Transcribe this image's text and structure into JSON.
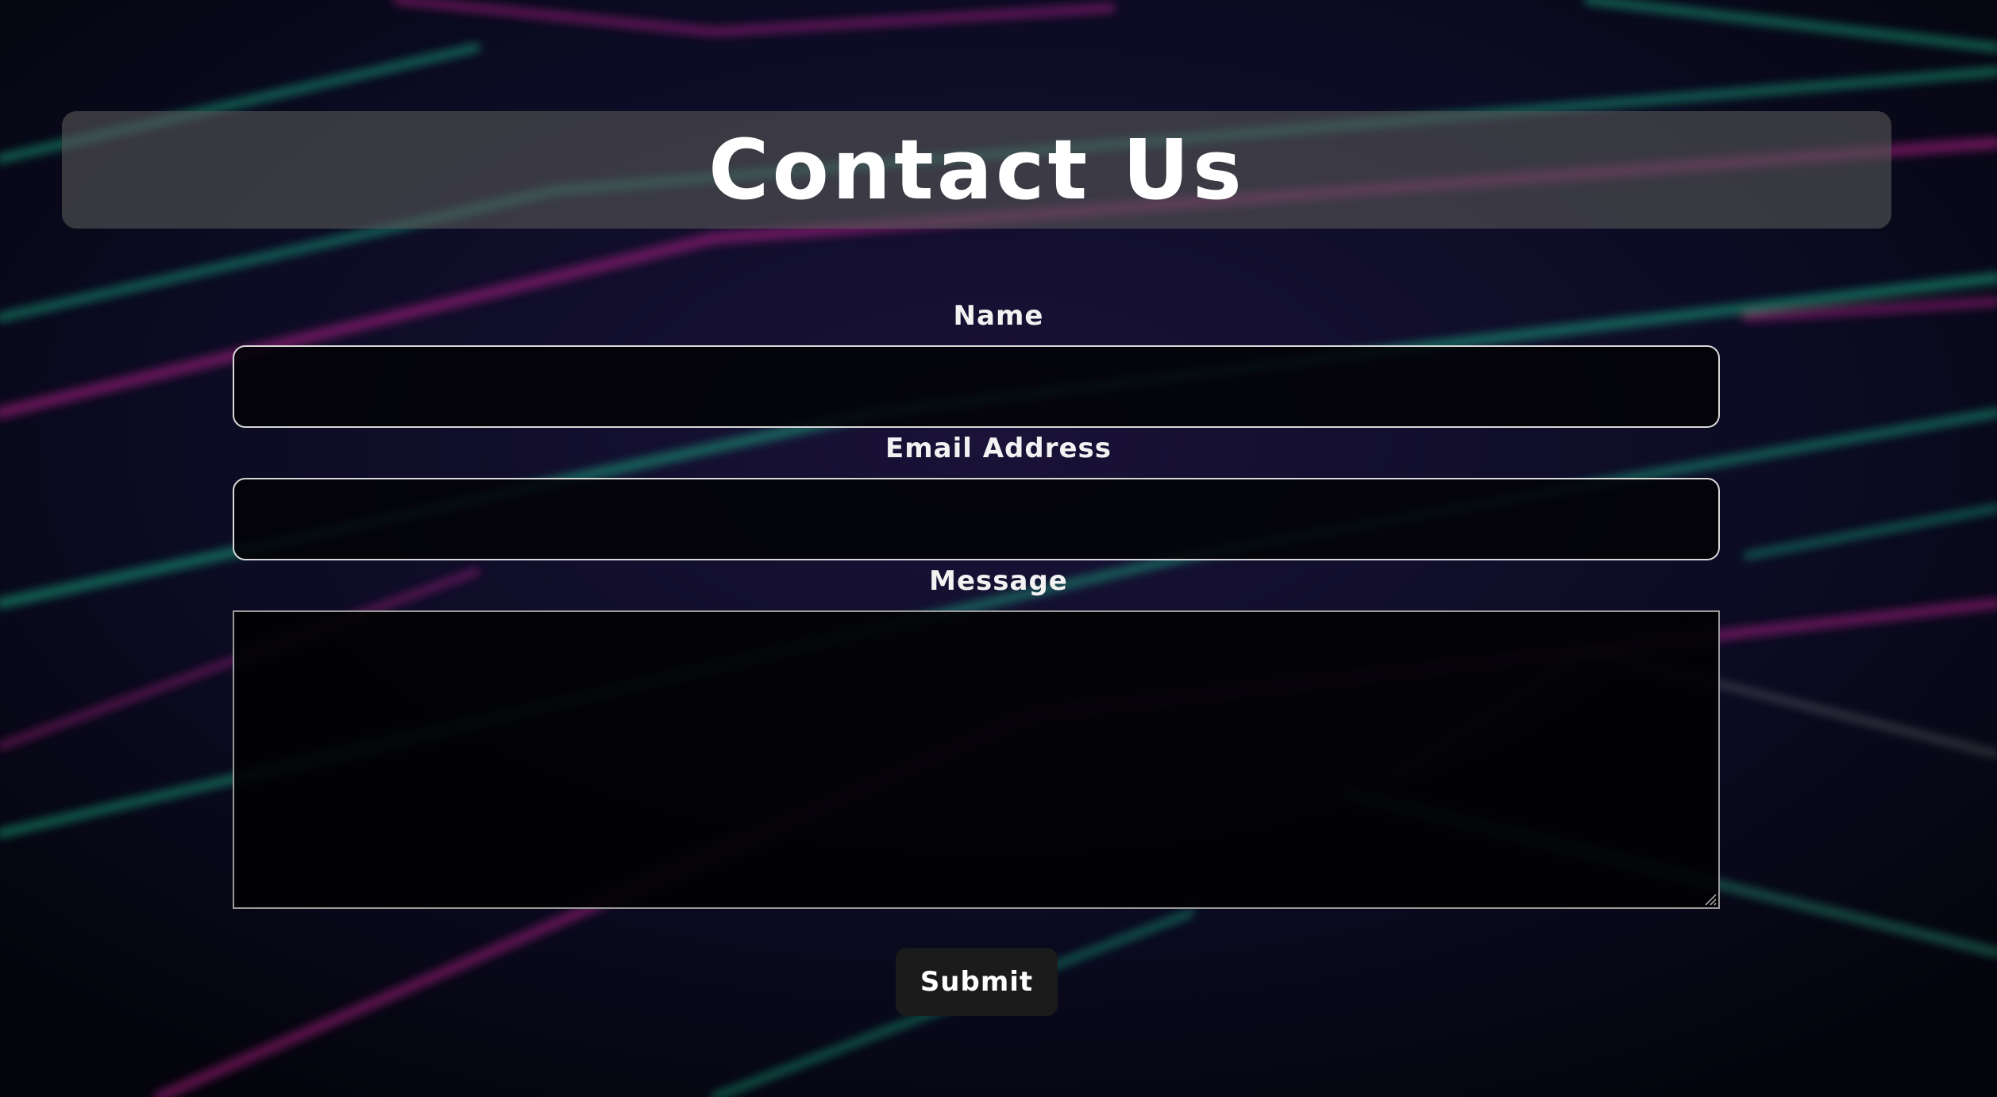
{
  "header": {
    "title": "Contact Us"
  },
  "form": {
    "name_label": "Name",
    "name_value": "",
    "email_label": "Email Address",
    "email_value": "",
    "message_label": "Message",
    "message_value": "",
    "submit_label": "Submit"
  },
  "colors": {
    "background": "#08081a",
    "header_panel": "#555555",
    "field_border": "#d8d8d8",
    "button": "#1b1b1b",
    "accent_green": "#1fbf8f",
    "accent_magenta": "#c0208f"
  }
}
